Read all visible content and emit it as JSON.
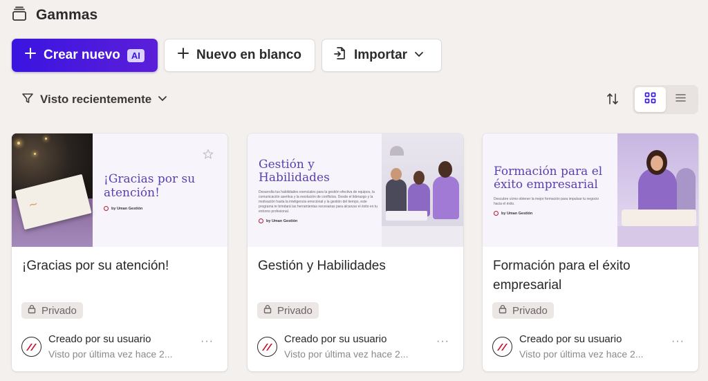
{
  "header": {
    "title": "Gammas",
    "icon": "stack-icon"
  },
  "toolbar": {
    "create_label": "Crear nuevo",
    "ai_badge": "AI",
    "blank_label": "Nuevo en blanco",
    "import_label": "Importar"
  },
  "filter": {
    "label": "Visto recientemente",
    "icon": "filter-icon"
  },
  "view": {
    "selected": "grid"
  },
  "colors": {
    "accent": "#3a14e0",
    "background": "#f4f0ee",
    "slide_title": "#5a3fb0"
  },
  "cards": [
    {
      "slide_title": "¡Gracias por su atención!",
      "slide_body": "",
      "byline": "by Uman Gestión",
      "name": "¡Gracias por su atención!",
      "privacy": "Privado",
      "creator": "Creado por su usuario",
      "seen": "Visto por última vez hace 2..."
    },
    {
      "slide_title": "Gestión y Habilidades",
      "slide_body": "Desarrolla tus habilidades esenciales para la gestión efectiva de equipos, la comunicación asertiva y la resolución de conflictos. Desde el liderazgo y la motivación hasta la inteligencia emocional y la gestión del tiempo, este programa te brindará las herramientas necesarias para alcanzar el éxito en tu entorno profesional.",
      "byline": "by Uman Gestión",
      "name": "Gestión y Habilidades",
      "privacy": "Privado",
      "creator": "Creado por su usuario",
      "seen": "Visto por última vez hace 2..."
    },
    {
      "slide_title": "Formación para el éxito empresarial",
      "slide_body": "Descubre cómo obtener la mejor formación para impulsar tu negocio hacia el éxito.",
      "byline": "by Uman Gestión",
      "name": "Formación para el éxito empresarial",
      "privacy": "Privado",
      "creator": "Creado por su usuario",
      "seen": "Visto por última vez hace 2..."
    }
  ]
}
